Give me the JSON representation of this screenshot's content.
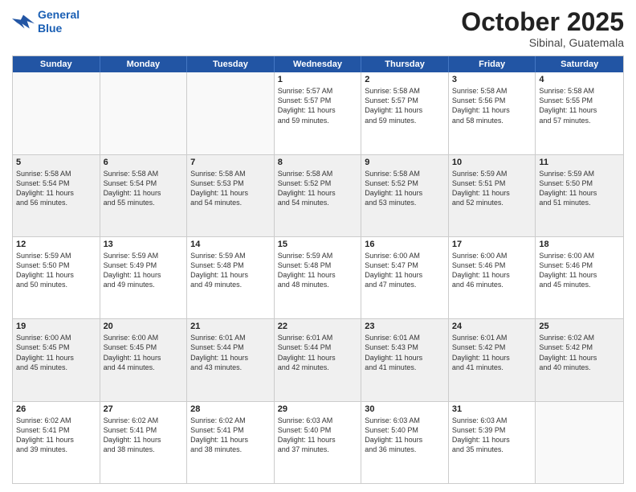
{
  "logo": {
    "line1": "General",
    "line2": "Blue"
  },
  "title": "October 2025",
  "subtitle": "Sibinal, Guatemala",
  "days": [
    "Sunday",
    "Monday",
    "Tuesday",
    "Wednesday",
    "Thursday",
    "Friday",
    "Saturday"
  ],
  "rows": [
    [
      {
        "day": "",
        "lines": [],
        "empty": true
      },
      {
        "day": "",
        "lines": [],
        "empty": true
      },
      {
        "day": "",
        "lines": [],
        "empty": true
      },
      {
        "day": "1",
        "lines": [
          "Sunrise: 5:57 AM",
          "Sunset: 5:57 PM",
          "Daylight: 11 hours",
          "and 59 minutes."
        ]
      },
      {
        "day": "2",
        "lines": [
          "Sunrise: 5:58 AM",
          "Sunset: 5:57 PM",
          "Daylight: 11 hours",
          "and 59 minutes."
        ]
      },
      {
        "day": "3",
        "lines": [
          "Sunrise: 5:58 AM",
          "Sunset: 5:56 PM",
          "Daylight: 11 hours",
          "and 58 minutes."
        ]
      },
      {
        "day": "4",
        "lines": [
          "Sunrise: 5:58 AM",
          "Sunset: 5:55 PM",
          "Daylight: 11 hours",
          "and 57 minutes."
        ]
      }
    ],
    [
      {
        "day": "5",
        "lines": [
          "Sunrise: 5:58 AM",
          "Sunset: 5:54 PM",
          "Daylight: 11 hours",
          "and 56 minutes."
        ]
      },
      {
        "day": "6",
        "lines": [
          "Sunrise: 5:58 AM",
          "Sunset: 5:54 PM",
          "Daylight: 11 hours",
          "and 55 minutes."
        ]
      },
      {
        "day": "7",
        "lines": [
          "Sunrise: 5:58 AM",
          "Sunset: 5:53 PM",
          "Daylight: 11 hours",
          "and 54 minutes."
        ]
      },
      {
        "day": "8",
        "lines": [
          "Sunrise: 5:58 AM",
          "Sunset: 5:52 PM",
          "Daylight: 11 hours",
          "and 54 minutes."
        ]
      },
      {
        "day": "9",
        "lines": [
          "Sunrise: 5:58 AM",
          "Sunset: 5:52 PM",
          "Daylight: 11 hours",
          "and 53 minutes."
        ]
      },
      {
        "day": "10",
        "lines": [
          "Sunrise: 5:59 AM",
          "Sunset: 5:51 PM",
          "Daylight: 11 hours",
          "and 52 minutes."
        ]
      },
      {
        "day": "11",
        "lines": [
          "Sunrise: 5:59 AM",
          "Sunset: 5:50 PM",
          "Daylight: 11 hours",
          "and 51 minutes."
        ]
      }
    ],
    [
      {
        "day": "12",
        "lines": [
          "Sunrise: 5:59 AM",
          "Sunset: 5:50 PM",
          "Daylight: 11 hours",
          "and 50 minutes."
        ]
      },
      {
        "day": "13",
        "lines": [
          "Sunrise: 5:59 AM",
          "Sunset: 5:49 PM",
          "Daylight: 11 hours",
          "and 49 minutes."
        ]
      },
      {
        "day": "14",
        "lines": [
          "Sunrise: 5:59 AM",
          "Sunset: 5:48 PM",
          "Daylight: 11 hours",
          "and 49 minutes."
        ]
      },
      {
        "day": "15",
        "lines": [
          "Sunrise: 5:59 AM",
          "Sunset: 5:48 PM",
          "Daylight: 11 hours",
          "and 48 minutes."
        ]
      },
      {
        "day": "16",
        "lines": [
          "Sunrise: 6:00 AM",
          "Sunset: 5:47 PM",
          "Daylight: 11 hours",
          "and 47 minutes."
        ]
      },
      {
        "day": "17",
        "lines": [
          "Sunrise: 6:00 AM",
          "Sunset: 5:46 PM",
          "Daylight: 11 hours",
          "and 46 minutes."
        ]
      },
      {
        "day": "18",
        "lines": [
          "Sunrise: 6:00 AM",
          "Sunset: 5:46 PM",
          "Daylight: 11 hours",
          "and 45 minutes."
        ]
      }
    ],
    [
      {
        "day": "19",
        "lines": [
          "Sunrise: 6:00 AM",
          "Sunset: 5:45 PM",
          "Daylight: 11 hours",
          "and 45 minutes."
        ]
      },
      {
        "day": "20",
        "lines": [
          "Sunrise: 6:00 AM",
          "Sunset: 5:45 PM",
          "Daylight: 11 hours",
          "and 44 minutes."
        ]
      },
      {
        "day": "21",
        "lines": [
          "Sunrise: 6:01 AM",
          "Sunset: 5:44 PM",
          "Daylight: 11 hours",
          "and 43 minutes."
        ]
      },
      {
        "day": "22",
        "lines": [
          "Sunrise: 6:01 AM",
          "Sunset: 5:44 PM",
          "Daylight: 11 hours",
          "and 42 minutes."
        ]
      },
      {
        "day": "23",
        "lines": [
          "Sunrise: 6:01 AM",
          "Sunset: 5:43 PM",
          "Daylight: 11 hours",
          "and 41 minutes."
        ]
      },
      {
        "day": "24",
        "lines": [
          "Sunrise: 6:01 AM",
          "Sunset: 5:42 PM",
          "Daylight: 11 hours",
          "and 41 minutes."
        ]
      },
      {
        "day": "25",
        "lines": [
          "Sunrise: 6:02 AM",
          "Sunset: 5:42 PM",
          "Daylight: 11 hours",
          "and 40 minutes."
        ]
      }
    ],
    [
      {
        "day": "26",
        "lines": [
          "Sunrise: 6:02 AM",
          "Sunset: 5:41 PM",
          "Daylight: 11 hours",
          "and 39 minutes."
        ]
      },
      {
        "day": "27",
        "lines": [
          "Sunrise: 6:02 AM",
          "Sunset: 5:41 PM",
          "Daylight: 11 hours",
          "and 38 minutes."
        ]
      },
      {
        "day": "28",
        "lines": [
          "Sunrise: 6:02 AM",
          "Sunset: 5:41 PM",
          "Daylight: 11 hours",
          "and 38 minutes."
        ]
      },
      {
        "day": "29",
        "lines": [
          "Sunrise: 6:03 AM",
          "Sunset: 5:40 PM",
          "Daylight: 11 hours",
          "and 37 minutes."
        ]
      },
      {
        "day": "30",
        "lines": [
          "Sunrise: 6:03 AM",
          "Sunset: 5:40 PM",
          "Daylight: 11 hours",
          "and 36 minutes."
        ]
      },
      {
        "day": "31",
        "lines": [
          "Sunrise: 6:03 AM",
          "Sunset: 5:39 PM",
          "Daylight: 11 hours",
          "and 35 minutes."
        ]
      },
      {
        "day": "",
        "lines": [],
        "empty": true
      }
    ]
  ]
}
